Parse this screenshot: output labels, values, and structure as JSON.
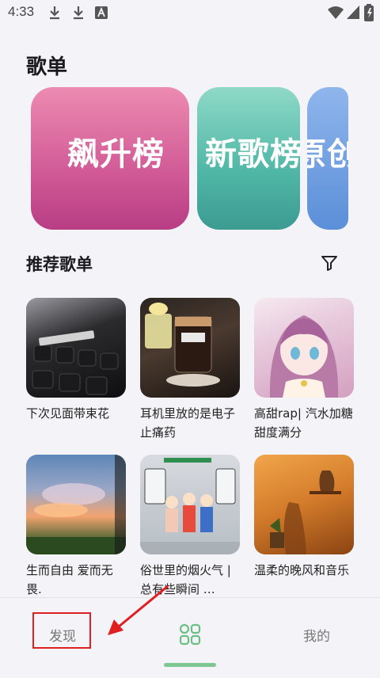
{
  "status_bar": {
    "time": "4:33"
  },
  "section": {
    "title": "歌单"
  },
  "charts": [
    {
      "label": "飙升榜"
    },
    {
      "label": "新歌榜"
    },
    {
      "label": "原创"
    }
  ],
  "recommended": {
    "title": "推荐歌单",
    "playlists": [
      {
        "caption": "下次见面带束花"
      },
      {
        "caption": "耳机里放的是电子止痛药"
      },
      {
        "caption": "高甜rap| 汽水加糖 甜度满分"
      },
      {
        "caption": "生而自由 爱而无畏."
      },
      {
        "caption": "俗世里的烟火气 | 总有些瞬间 …"
      },
      {
        "caption": "温柔的晚风和音乐"
      }
    ]
  },
  "bottom_nav": {
    "discover": "发现",
    "mine": "我的"
  },
  "colors": {
    "accent": "#7cc792",
    "highlight": "#e02020"
  }
}
